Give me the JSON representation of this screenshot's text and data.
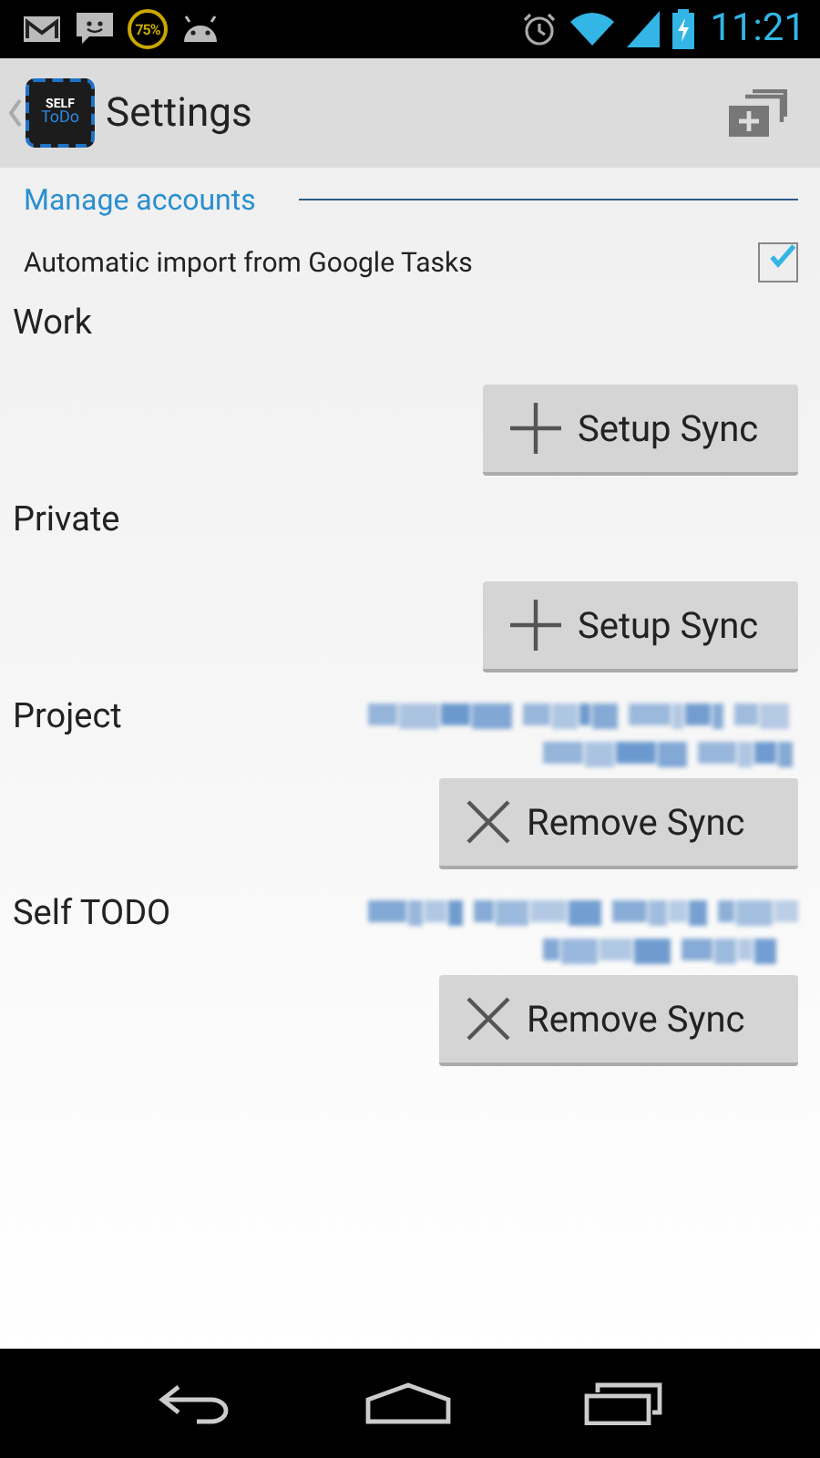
{
  "status_bar": {
    "battery_badge": "75%",
    "time": "11:21"
  },
  "action_bar": {
    "logo": {
      "top": "SELF",
      "bottom": "ToDo"
    },
    "title": "Settings"
  },
  "section": {
    "title": "Manage accounts"
  },
  "auto_import": {
    "label": "Automatic import from Google Tasks",
    "checked": true
  },
  "accounts": [
    {
      "name": "Work",
      "email_hidden": false,
      "button": {
        "kind": "setup",
        "label": "Setup Sync"
      }
    },
    {
      "name": "Private",
      "email_hidden": false,
      "button": {
        "kind": "setup",
        "label": "Setup Sync"
      }
    },
    {
      "name": "Project",
      "email_hidden": true,
      "button": {
        "kind": "remove",
        "label": "Remove Sync"
      }
    },
    {
      "name": "Self TODO",
      "email_hidden": true,
      "button": {
        "kind": "remove",
        "label": "Remove Sync"
      }
    }
  ]
}
